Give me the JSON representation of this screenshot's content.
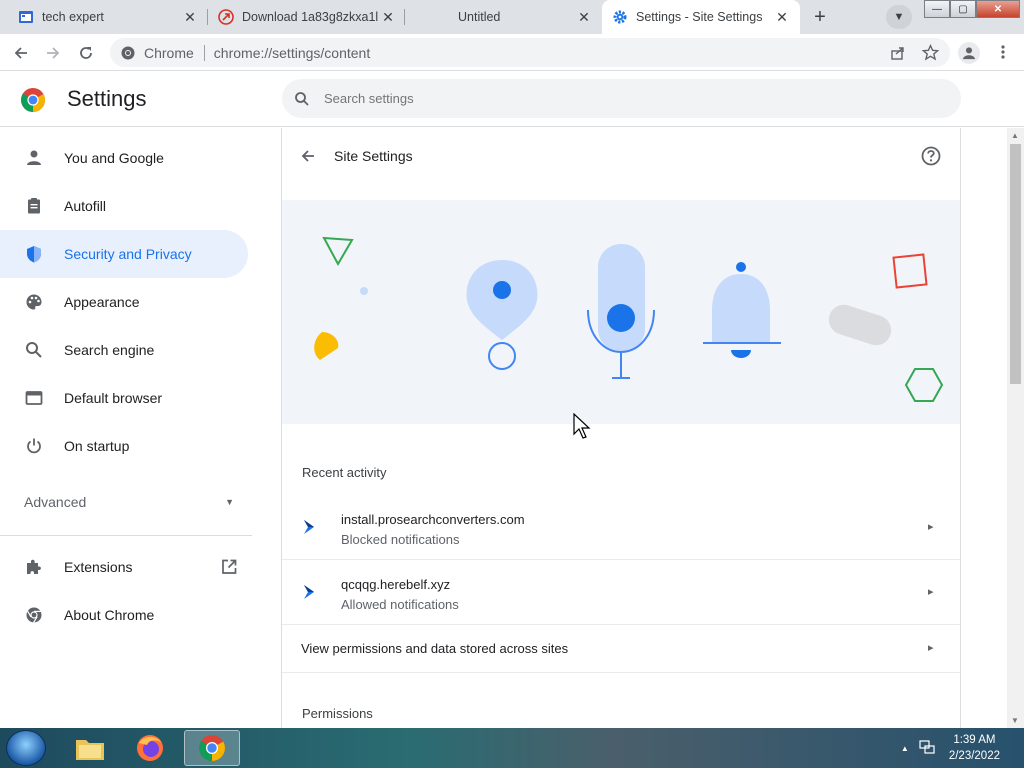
{
  "tabs": [
    {
      "title": "tech expert",
      "close": "✕",
      "icon": "calendar-doc-icon"
    },
    {
      "title": "Download 1a83g8zkxa1l",
      "close": "✕",
      "icon": "download-site-icon"
    },
    {
      "title": "Untitled",
      "close": "✕",
      "icon": ""
    },
    {
      "title": "Settings - Site Settings",
      "close": "✕",
      "icon": "settings-gear-icon",
      "active": true
    }
  ],
  "toolbar": {
    "site_label": "Chrome",
    "url": "chrome://settings/content"
  },
  "header": {
    "title": "Settings",
    "search_placeholder": "Search settings"
  },
  "sidebar": {
    "items": [
      {
        "label": "You and Google",
        "icon": "person-icon"
      },
      {
        "label": "Autofill",
        "icon": "clipboard-icon"
      },
      {
        "label": "Security and Privacy",
        "icon": "shield-icon",
        "active": true
      },
      {
        "label": "Appearance",
        "icon": "palette-icon"
      },
      {
        "label": "Search engine",
        "icon": "search-icon"
      },
      {
        "label": "Default browser",
        "icon": "browser-window-icon"
      },
      {
        "label": "On startup",
        "icon": "power-icon"
      }
    ],
    "advanced": "Advanced",
    "extensions": "Extensions",
    "about": "About Chrome"
  },
  "main": {
    "subpage_title": "Site Settings",
    "recent_activity_label": "Recent activity",
    "activity": [
      {
        "site": "install.prosearchconverters.com",
        "status": "Blocked notifications"
      },
      {
        "site": "qcqqg.herebelf.xyz",
        "status": "Allowed notifications"
      }
    ],
    "view_permissions": "View permissions and data stored across sites",
    "permissions_label": "Permissions"
  },
  "taskbar": {
    "time": "1:39 AM",
    "date": "2/23/2022"
  },
  "colors": {
    "accent": "#1a73e8",
    "active_bg": "#e8f0fe",
    "banner_bg": "#f1f4f8"
  }
}
